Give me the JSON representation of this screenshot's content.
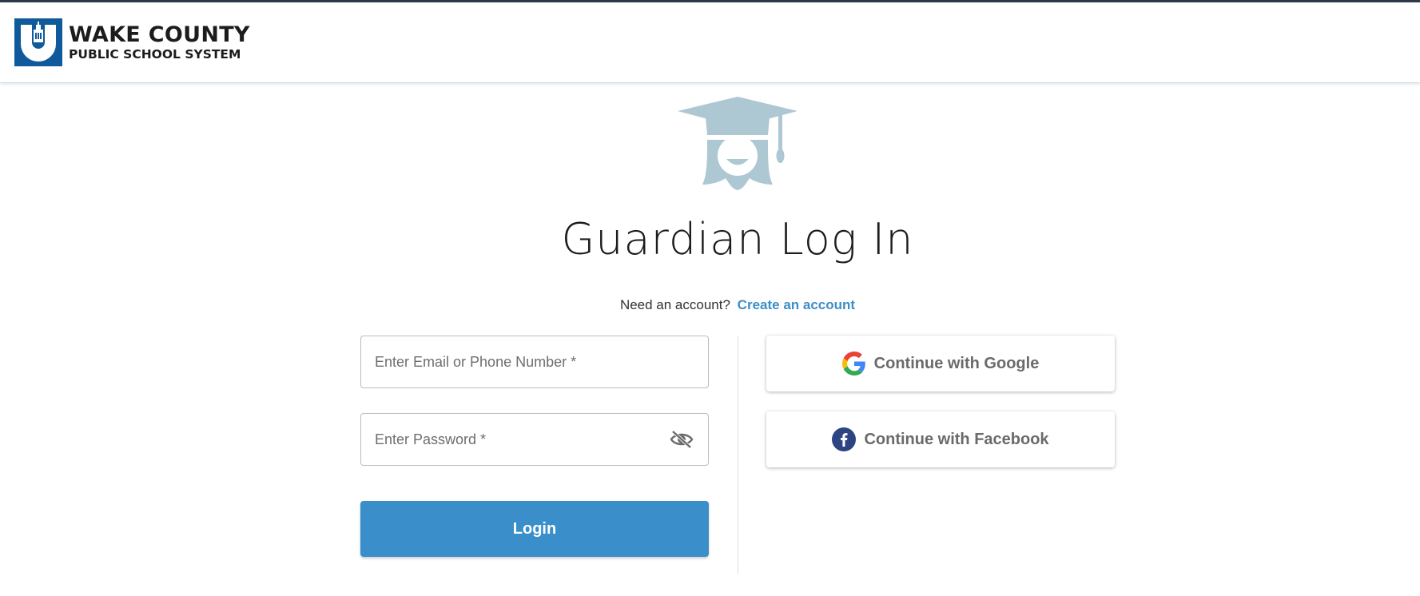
{
  "header": {
    "logo_line1": "WAKE COUNTY",
    "logo_line2": "PUBLIC SCHOOL SYSTEM"
  },
  "page": {
    "title": "Guardian Log In",
    "need_account_text": "Need an account?",
    "create_account_link": "Create an account"
  },
  "form": {
    "email_placeholder": "Enter Email or Phone Number *",
    "password_placeholder": "Enter Password *",
    "login_label": "Login"
  },
  "social": {
    "google_label": "Continue with Google",
    "facebook_label": "Continue with Facebook"
  },
  "icons": {
    "hero": "graduate-icon",
    "password_toggle": "eye-off-icon",
    "google": "google-icon",
    "facebook": "facebook-icon"
  },
  "colors": {
    "accent": "#3a8fca",
    "link": "#3b8fc7",
    "hero_icon": "#aec8d3",
    "logo_blue": "#0e5a9a",
    "facebook_blue": "#2c4482"
  }
}
